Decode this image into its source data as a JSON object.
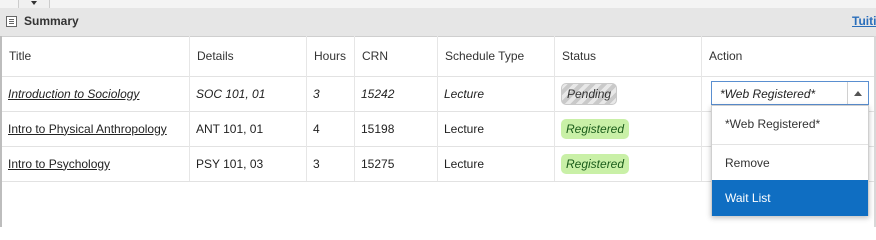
{
  "summary": {
    "title": "Summary",
    "right_link": "Tuiti"
  },
  "table": {
    "headers": [
      "Title",
      "Details",
      "Hours",
      "CRN",
      "Schedule Type",
      "Status",
      "Action"
    ],
    "rows": [
      {
        "title": "Introduction to Sociology",
        "details": "SOC 101, 01",
        "hours": "3",
        "crn": "15242",
        "schedule_type": "Lecture",
        "status": "Pending"
      },
      {
        "title": "Intro to Physical Anthropology",
        "details": "ANT 101, 01",
        "hours": "4",
        "crn": "15198",
        "schedule_type": "Lecture",
        "status": "Registered"
      },
      {
        "title": "Intro to Psychology",
        "details": "PSY 101, 03",
        "hours": "3",
        "crn": "15275",
        "schedule_type": "Lecture",
        "status": "Registered"
      }
    ]
  },
  "action_select": {
    "selected": "*Web Registered*",
    "options": [
      "*Web Registered*",
      "Remove",
      "Wait List"
    ],
    "highlighted": "Wait List"
  },
  "colors": {
    "registered_bg": "#c9f0a7",
    "highlight": "#0f6ec2",
    "header_bg": "#e6e6e6"
  },
  "icons": [
    "dropdown-arrow-icon",
    "summary-icon",
    "chevron-up-icon"
  ]
}
